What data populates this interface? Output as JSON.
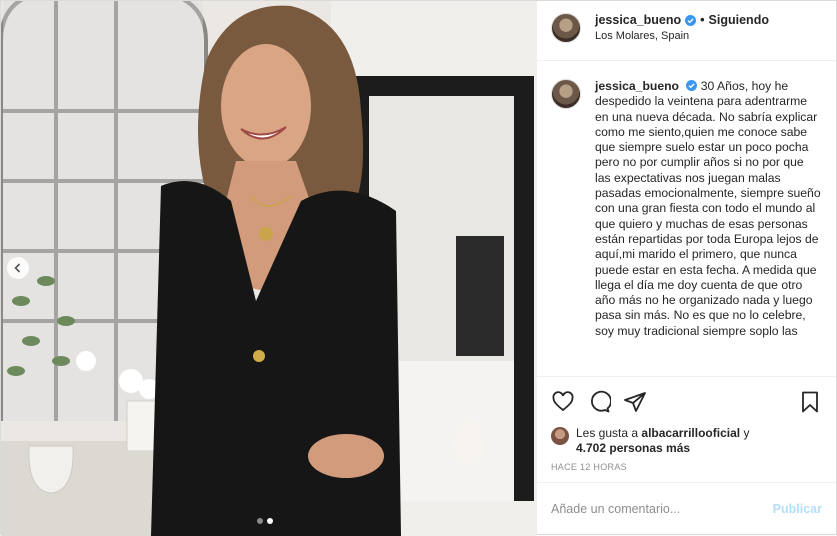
{
  "header": {
    "username": "jessica_bueno",
    "separator": "•",
    "follow_label": "Siguiendo",
    "location": "Los Molares, Spain"
  },
  "caption": {
    "username": "jessica_bueno",
    "text": "30 Años, hoy he despedido la veintena para adentrarme en una nueva década. No sabría explicar como me siento,quien me conoce sabe que siempre suelo estar un poco pocha pero no por cumplir años si no por que las expectativas nos juegan malas pasadas emocionalmente, siempre sueño con una gran fiesta con todo el mundo al que quiero y muchas de esas personas están repartidas por toda Europa lejos de aquí,mi marido el primero, que nunca puede estar en esta fecha. A medida que llega el día me doy cuenta de que otro año más no he organizado nada y luego pasa sin más. No es que no lo celebre, soy muy tradicional siempre soplo las"
  },
  "likes": {
    "prefix": "Les gusta a",
    "user": "albacarrillooficial",
    "conj": "y",
    "count": "4.702 personas más"
  },
  "time": "HACE 12 HORAS",
  "comment": {
    "placeholder": "Añade un comentario...",
    "publish_label": "Publicar"
  },
  "carousel": {
    "total": 2,
    "current": 2
  },
  "icons": {
    "verified": "verified-badge-icon",
    "like": "heart-icon",
    "comment": "comment-bubble-icon",
    "share": "paper-plane-icon",
    "save": "bookmark-icon",
    "prev": "chevron-left-icon"
  },
  "colors": {
    "verified": "#3897f0",
    "publish": "#b2dffc",
    "muted": "#8e8e8e"
  }
}
